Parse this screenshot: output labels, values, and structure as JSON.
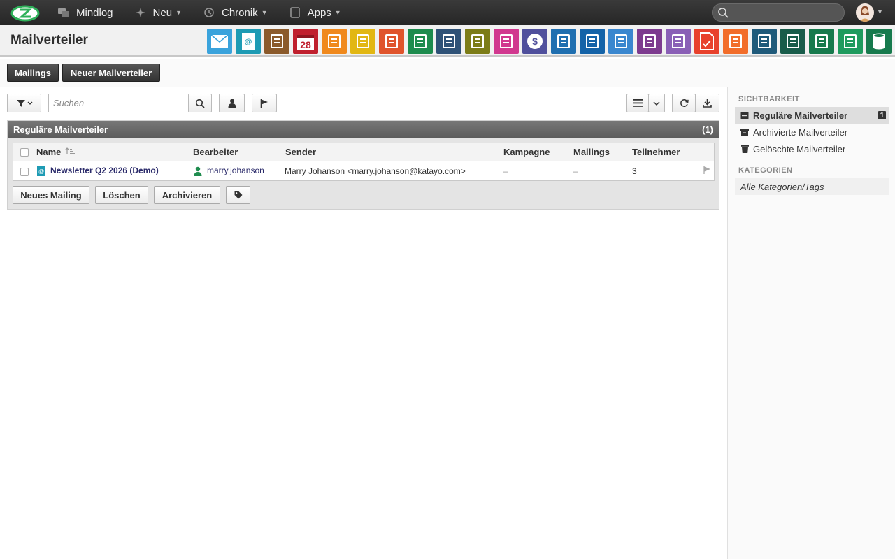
{
  "topbar": {
    "nav": [
      {
        "label": "Mindlog",
        "icon": "chat-icon",
        "has_chevron": false
      },
      {
        "label": "Neu",
        "icon": "sparkle-icon",
        "has_chevron": true
      },
      {
        "label": "Chronik",
        "icon": "history-icon",
        "has_chevron": true
      },
      {
        "label": "Apps",
        "icon": "tablet-icon",
        "has_chevron": true
      }
    ],
    "search_placeholder": ""
  },
  "header": {
    "title": "Mailverteiler",
    "apps": [
      {
        "icon": "envelope-icon",
        "color": "#3aa3dc"
      },
      {
        "icon": "address-book-icon",
        "color": "#1e9bb4"
      },
      {
        "icon": "contacts-icon",
        "color": "#8b5a2b"
      },
      {
        "icon": "calendar-icon",
        "color": "#c0202e",
        "text": "28"
      },
      {
        "icon": "stopwatch-icon",
        "color": "#f0891d"
      },
      {
        "icon": "tasks-icon",
        "color": "#e2b713"
      },
      {
        "icon": "project-icon",
        "color": "#e0542c"
      },
      {
        "icon": "notes-icon",
        "color": "#1e8c4e"
      },
      {
        "icon": "bookmark-icon",
        "color": "#2f5277"
      },
      {
        "icon": "document-icon",
        "color": "#7c7c17"
      },
      {
        "icon": "cashier-icon",
        "color": "#d1388f"
      },
      {
        "icon": "dollar-icon",
        "color": "#4f4f9c"
      },
      {
        "icon": "truck-icon",
        "color": "#1f6fb0"
      },
      {
        "icon": "piggybank-icon",
        "color": "#1463a8"
      },
      {
        "icon": "moneybag-icon",
        "color": "#3a87cf"
      },
      {
        "icon": "certificate-icon",
        "color": "#7d3b8f"
      },
      {
        "icon": "handshake-icon",
        "color": "#8a5fb6"
      },
      {
        "icon": "pdf-icon",
        "color": "#e8412c"
      },
      {
        "icon": "broadcast-icon",
        "color": "#f26d2a"
      },
      {
        "icon": "download-icon",
        "color": "#1f5a7a"
      },
      {
        "icon": "cart-icon",
        "color": "#185c4a"
      },
      {
        "icon": "coins-icon",
        "color": "#177a4d"
      },
      {
        "icon": "pricetag-icon",
        "color": "#1f9b5e"
      },
      {
        "icon": "database-icon",
        "color": "#177a4d"
      }
    ]
  },
  "tabs": {
    "mailings": "Mailings",
    "new_list": "Neuer Mailverteiler"
  },
  "toolbar": {
    "search_placeholder": "Suchen"
  },
  "panel": {
    "title": "Reguläre Mailverteiler",
    "count": "(1)",
    "columns": [
      "Name",
      "Bearbeiter",
      "Sender",
      "Kampagne",
      "Mailings",
      "Teilnehmer"
    ],
    "rows": [
      {
        "name": "Newsletter Q2 2026 (Demo)",
        "editor": "marry.johanson",
        "sender": "Marry Johanson <marry.johanson@katayo.com>",
        "campaign": "–",
        "mailings": "–",
        "participants": "3"
      }
    ],
    "actions": {
      "new_mailing": "Neues Mailing",
      "delete": "Löschen",
      "archive": "Archivieren"
    }
  },
  "sidebar": {
    "visibility_head": "SICHTBARKEIT",
    "items": [
      {
        "label": "Reguläre Mailverteiler",
        "badge": "1",
        "active": true,
        "icon": "inbox-icon"
      },
      {
        "label": "Archivierte Mailverteiler",
        "active": false,
        "icon": "archive-icon"
      },
      {
        "label": "Gelöschte Mailverteiler",
        "active": false,
        "icon": "trash-icon"
      }
    ],
    "categories_head": "KATEGORIEN",
    "categories_all": "Alle Kategorien/Tags"
  }
}
